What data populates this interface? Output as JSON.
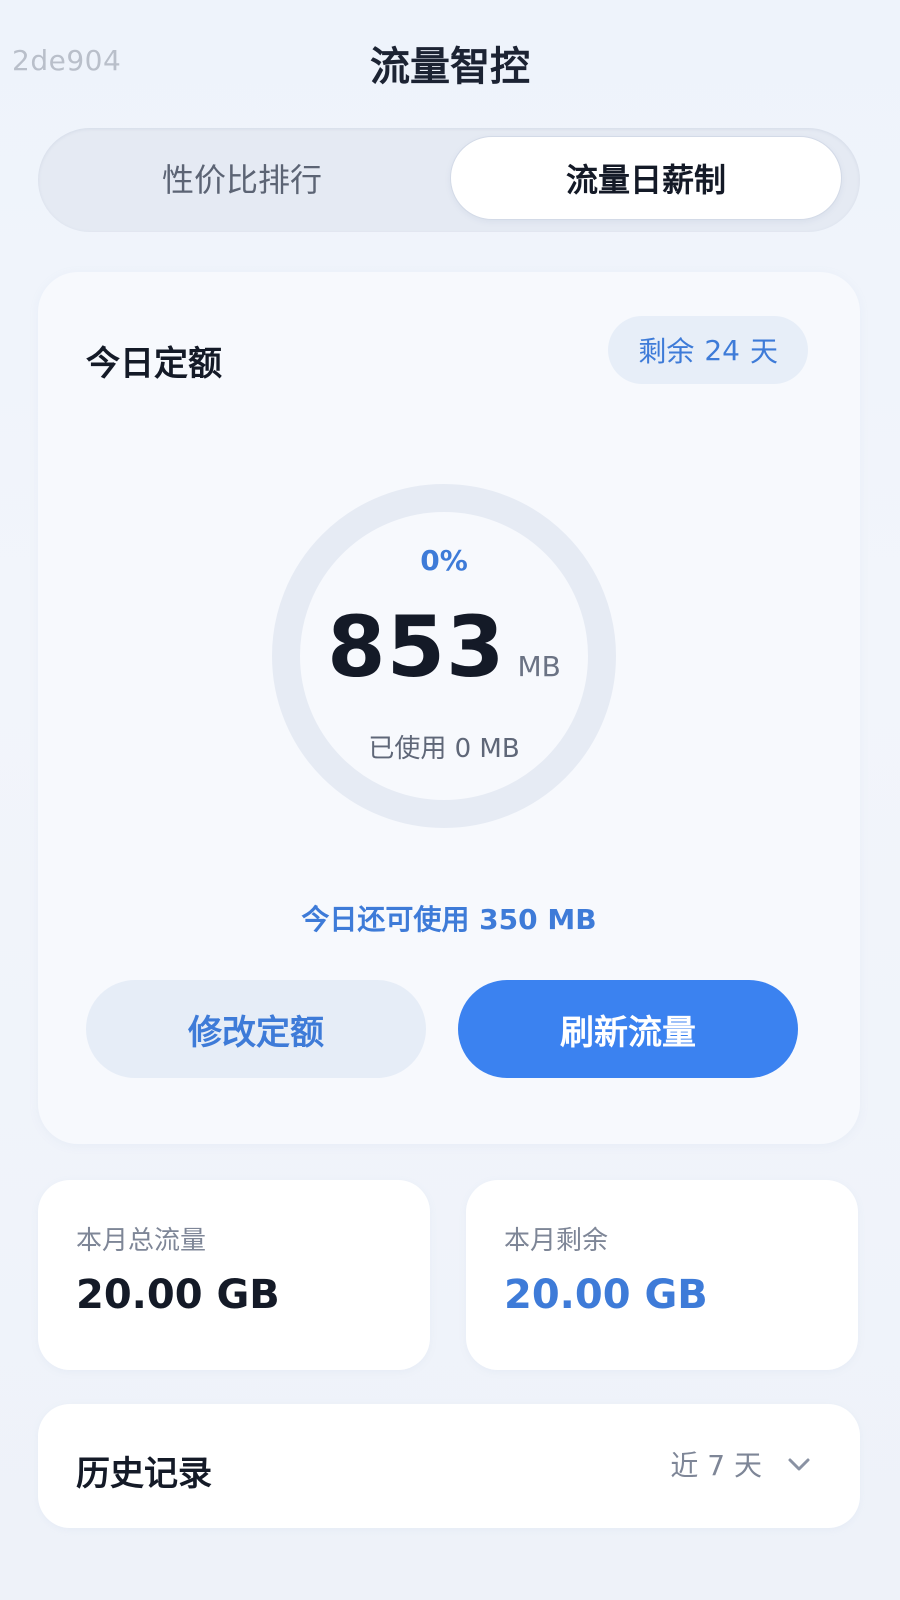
{
  "watermark": "2de904",
  "app": {
    "title": "流量智控"
  },
  "tabs": [
    {
      "label": "性价比排行",
      "active": false
    },
    {
      "label": "流量日薪制",
      "active": true
    }
  ],
  "quota": {
    "title": "今日定额",
    "days_left_label": "剩余",
    "days_left_value": "24",
    "days_left_unit": "天",
    "percent_used": "0%",
    "percent_value": 0,
    "value": "853",
    "unit": "MB",
    "used_text": "已使用 0 MB",
    "remaining_today_text": "今日还可使用 350 MB",
    "edit_button": "修改定额",
    "refresh_button": "刷新流量"
  },
  "stats": {
    "month_total_label": "本月总流量",
    "month_total_value": "20.00 GB",
    "month_remaining_label": "本月剩余",
    "month_remaining_value": "20.00 GB"
  },
  "history": {
    "title": "历史记录",
    "range": "近 7 天"
  },
  "colors": {
    "accent": "#3e7bd8",
    "primary_button": "#3b82f0",
    "ring_track": "#e6ebf4"
  }
}
